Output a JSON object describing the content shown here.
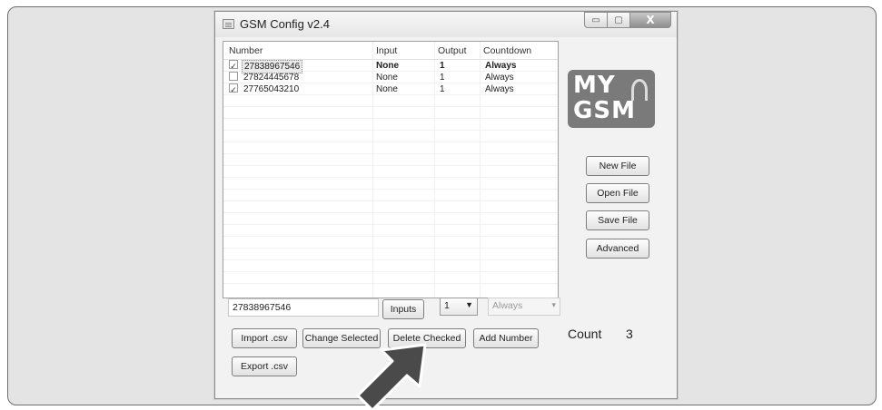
{
  "window": {
    "title": "GSM Config v2.4",
    "controls": {
      "minimize": "▭",
      "maximize": "▢",
      "close": "X"
    }
  },
  "list": {
    "columns": [
      "Number",
      "Input",
      "Output",
      "Countdown"
    ],
    "rows": [
      {
        "checked": true,
        "number": "27838967546",
        "input": "None",
        "output": "1",
        "countdown": "Always",
        "selected": true
      },
      {
        "checked": false,
        "number": "27824445678",
        "input": "None",
        "output": "1",
        "countdown": "Always",
        "selected": false
      },
      {
        "checked": true,
        "number": "27765043210",
        "input": "None",
        "output": "1",
        "countdown": "Always",
        "selected": false
      }
    ]
  },
  "logo": {
    "line1": "MY",
    "line2": "GSM"
  },
  "side_buttons": {
    "new_file": "New File",
    "open_file": "Open File",
    "save_file": "Save File",
    "advanced": "Advanced"
  },
  "editor": {
    "number_value": "27838967546",
    "inputs_button": "Inputs",
    "output_value": "1",
    "countdown_value": "Always"
  },
  "actions": {
    "import_csv": "Import .csv",
    "change_selected": "Change Selected",
    "delete_checked": "Delete Checked",
    "add_number": "Add Number",
    "export_csv": "Export .csv"
  },
  "count": {
    "label": "Count",
    "value": "3"
  },
  "check_glyph": "✓"
}
